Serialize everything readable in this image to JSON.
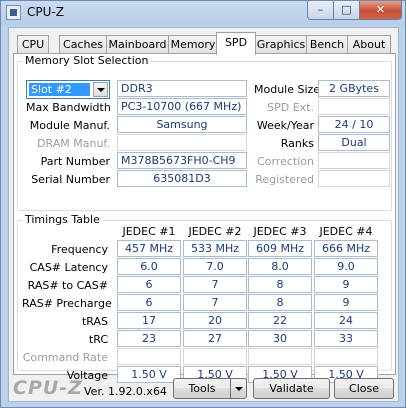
{
  "window": {
    "title": "CPU-Z",
    "min_label": "–",
    "max_label": "□",
    "close_label": "✕"
  },
  "tabs": [
    {
      "label": "CPU"
    },
    {
      "label": "Caches"
    },
    {
      "label": "Mainboard"
    },
    {
      "label": "Memory"
    },
    {
      "label": "SPD"
    },
    {
      "label": "Graphics"
    },
    {
      "label": "Bench"
    },
    {
      "label": "About"
    }
  ],
  "slot_section": {
    "title": "Memory Slot Selection",
    "slot_selected": "Slot #2",
    "memory_type": "DDR3",
    "module_size_label": "Module Size",
    "module_size": "2 GBytes",
    "max_bandwidth_label": "Max Bandwidth",
    "max_bandwidth": "PC3-10700 (667 MHz)",
    "spd_ext_label": "SPD Ext.",
    "spd_ext": "",
    "module_manuf_label": "Module Manuf.",
    "module_manuf": "Samsung",
    "week_year_label": "Week/Year",
    "week_year": "24 / 10",
    "dram_manuf_label": "DRAM Manuf.",
    "dram_manuf": "",
    "ranks_label": "Ranks",
    "ranks": "Dual",
    "part_number_label": "Part Number",
    "part_number": "M378B5673FH0-CH9",
    "correction_label": "Correction",
    "correction": "",
    "serial_number_label": "Serial Number",
    "serial_number": "635081D3",
    "registered_label": "Registered",
    "registered": ""
  },
  "timings": {
    "title": "Timings Table",
    "columns": [
      "JEDEC #1",
      "JEDEC #2",
      "JEDEC #3",
      "JEDEC #4"
    ],
    "rows": [
      {
        "label": "Frequency",
        "values": [
          "457 MHz",
          "533 MHz",
          "609 MHz",
          "666 MHz"
        ]
      },
      {
        "label": "CAS# Latency",
        "values": [
          "6.0",
          "7.0",
          "8.0",
          "9.0"
        ]
      },
      {
        "label": "RAS# to CAS#",
        "values": [
          "6",
          "7",
          "8",
          "9"
        ]
      },
      {
        "label": "RAS# Precharge",
        "values": [
          "6",
          "7",
          "8",
          "9"
        ]
      },
      {
        "label": "tRAS",
        "values": [
          "17",
          "20",
          "22",
          "24"
        ]
      },
      {
        "label": "tRC",
        "values": [
          "23",
          "27",
          "30",
          "33"
        ]
      },
      {
        "label": "Command Rate",
        "values": [
          "",
          "",
          "",
          ""
        ]
      },
      {
        "label": "Voltage",
        "values": [
          "1.50 V",
          "1.50 V",
          "1.50 V",
          "1.50 V"
        ]
      }
    ]
  },
  "footer": {
    "brand": "CPU-Z",
    "version": "Ver. 1.92.0.x64",
    "tools_label": "Tools",
    "validate_label": "Validate",
    "close_label": "Close"
  }
}
